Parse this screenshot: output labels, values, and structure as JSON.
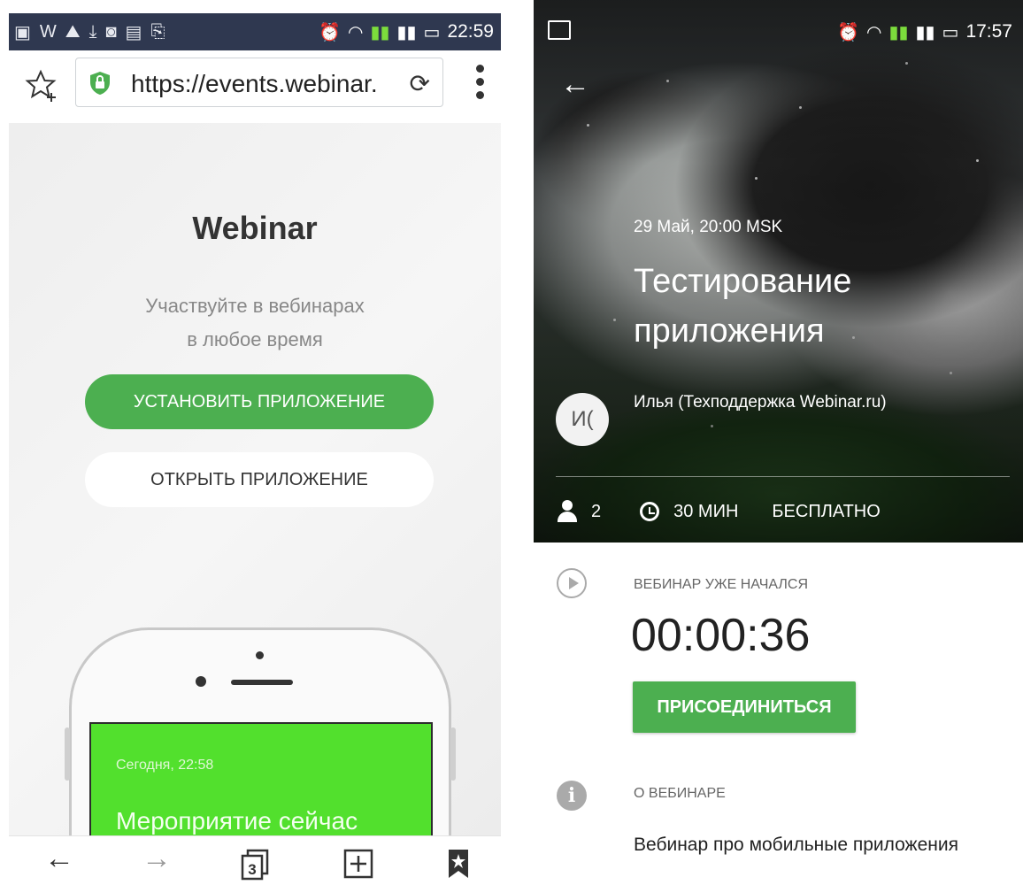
{
  "left": {
    "status": {
      "time": "22:59",
      "letter": "W"
    },
    "browser": {
      "url": "https://events.webinar.",
      "reload_glyph": "⟳",
      "star_glyph": "☆₊"
    },
    "page": {
      "title": "Webinar",
      "subtitle_line1": "Участвуйте в вебинарах",
      "subtitle_line2": "в любое время",
      "install_label": "УСТАНОВИТЬ ПРИЛОЖЕНИЕ",
      "open_label": "ОТКРЫТЬ ПРИЛОЖЕНИЕ",
      "phone_screen": {
        "date": "Сегодня, 22:58",
        "title": "Мероприятие сейчас"
      }
    },
    "bottom_nav": {
      "back": "←",
      "forward": "→",
      "tabs_count": "3",
      "new_tab": "⊞",
      "bookmark": "🔖"
    }
  },
  "right": {
    "status": {
      "time": "17:57"
    },
    "event": {
      "date": "29 Май, 20:00 MSK",
      "title": "Тестирование приложения",
      "avatar_initials": "И(",
      "author": "Илья (Техподдержка Webinar.ru)",
      "participants": "2",
      "duration": "30 МИН",
      "price": "БЕСПЛАТНО"
    },
    "started_label": "ВЕБИНАР УЖЕ НАЧАЛСЯ",
    "timer": "00:00:36",
    "join_label": "ПРИСОЕДИНИТЬСЯ",
    "about_label": "О ВЕБИНАРЕ",
    "about_text": "Вебинар про мобильные приложения"
  },
  "colors": {
    "accent_green": "#4caf50",
    "status_bar": "#2f3850",
    "screen_green": "#52e02d"
  },
  "icons": [
    "star-plus-icon",
    "lock-icon",
    "reload-icon",
    "kebab-menu-icon",
    "back-arrow-icon",
    "forward-arrow-icon",
    "tabs-icon",
    "new-tab-icon",
    "bookmark-icon",
    "person-icon",
    "clock-icon",
    "play-circle-icon",
    "info-icon"
  ]
}
